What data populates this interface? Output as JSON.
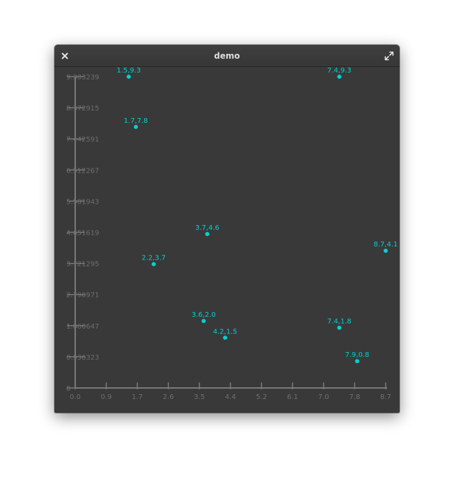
{
  "window": {
    "title": "demo",
    "close_icon": "close-icon",
    "maximize_icon": "maximize-icon"
  },
  "colors": {
    "background": "#393939",
    "axis": "#7a7a7a",
    "tick_label": "#6e6e6e",
    "point": "#00d2d2",
    "point_label": "#00d2d2"
  },
  "chart_data": {
    "type": "scatter",
    "title": "",
    "xlabel": "",
    "ylabel": "",
    "xlim": [
      0,
      8.7
    ],
    "ylim": [
      0,
      9.303239
    ],
    "x_ticks": [
      "0.0",
      "0.9",
      "1.7",
      "2.6",
      "3.5",
      "4.4",
      "5.2",
      "6.1",
      "7.0",
      "7.8",
      "8.7"
    ],
    "y_ticks": [
      "0",
      "0.930323",
      "1.860647",
      "2.790971",
      "3.721295",
      "4.651619",
      "5.581943",
      "6.512267",
      "7.442591",
      "8.372915",
      "9.303239"
    ],
    "grid": false,
    "points": [
      {
        "x": 1.5,
        "y": 9.3,
        "label": "1.5,9.3"
      },
      {
        "x": 7.4,
        "y": 9.3,
        "label": "7.4,9.3"
      },
      {
        "x": 1.7,
        "y": 7.8,
        "label": "1.7,7.8"
      },
      {
        "x": 3.7,
        "y": 4.6,
        "label": "3.7,4.6"
      },
      {
        "x": 8.7,
        "y": 4.1,
        "label": "8.7,4.1"
      },
      {
        "x": 2.2,
        "y": 3.7,
        "label": "2.2,3.7"
      },
      {
        "x": 3.6,
        "y": 2.0,
        "label": "3.6,2.0"
      },
      {
        "x": 7.4,
        "y": 1.8,
        "label": "7.4,1.8"
      },
      {
        "x": 4.2,
        "y": 1.5,
        "label": "4.2,1.5"
      },
      {
        "x": 7.9,
        "y": 0.8,
        "label": "7.9,0.8"
      }
    ]
  }
}
